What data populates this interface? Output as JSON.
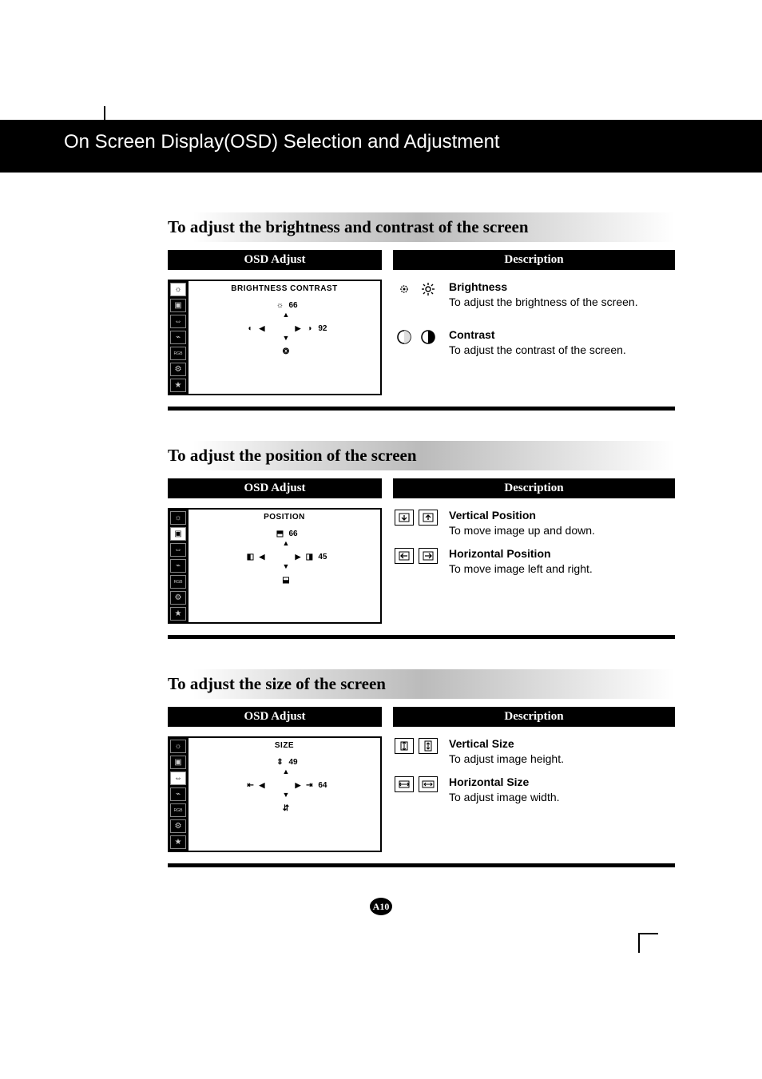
{
  "title": "On Screen Display(OSD) Selection and Adjustment",
  "page_number": "A10",
  "sections": [
    {
      "heading": "To adjust the brightness and contrast of the screen",
      "col_left_label": "OSD Adjust",
      "col_right_label": "Description",
      "osd": {
        "title": "BRIGHTNESS CONTRAST",
        "brightness_value": "66",
        "contrast_value": "92"
      },
      "items": [
        {
          "title": "Brightness",
          "body": "To adjust the brightness of the screen."
        },
        {
          "title": "Contrast",
          "body": "To adjust the contrast of the screen."
        }
      ]
    },
    {
      "heading": "To adjust the position of the screen",
      "col_left_label": "OSD Adjust",
      "col_right_label": "Description",
      "osd": {
        "title": "POSITION",
        "v_value": "66",
        "h_value": "45"
      },
      "items": [
        {
          "title": "Vertical Position",
          "body": "To move image up and down."
        },
        {
          "title": "Horizontal Position",
          "body": "To move image left and right."
        }
      ]
    },
    {
      "heading": "To adjust the size of the screen",
      "col_left_label": "OSD Adjust",
      "col_right_label": "Description",
      "osd": {
        "title": "SIZE",
        "v_value": "49",
        "h_value": "64"
      },
      "items": [
        {
          "title": "Vertical Size",
          "body": "To adjust image height."
        },
        {
          "title": "Horizontal Size",
          "body": "To adjust image width."
        }
      ]
    }
  ]
}
